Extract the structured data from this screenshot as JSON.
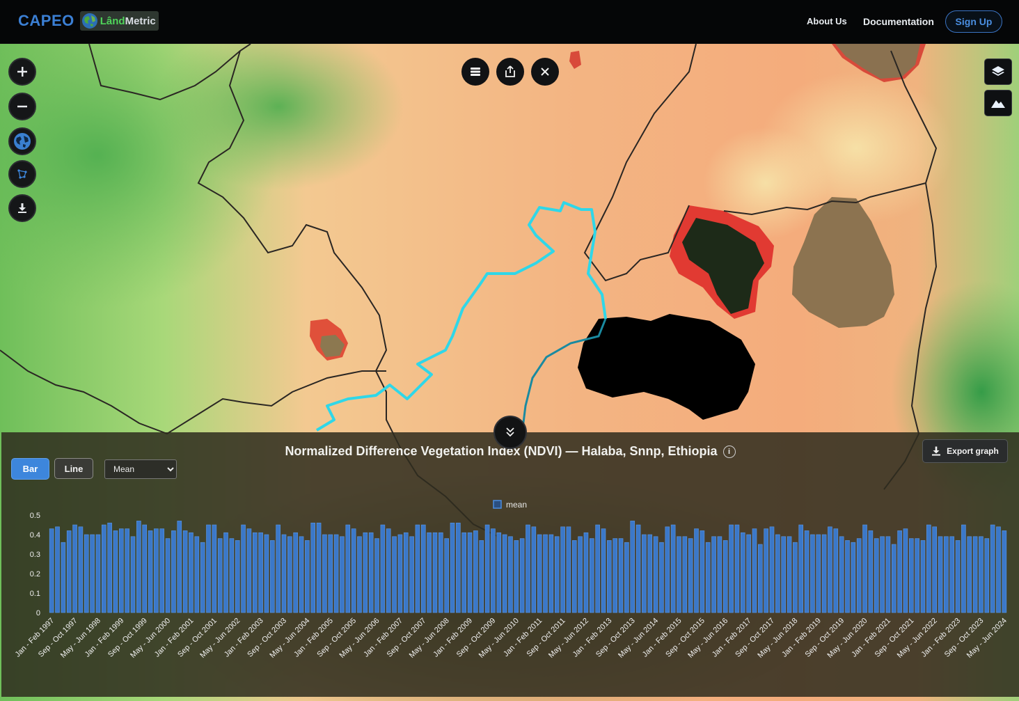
{
  "header": {
    "brand": "CAPEO",
    "logo_land": "Lând",
    "logo_metric": "Metric",
    "nav": [
      "About Us",
      "Documentation"
    ],
    "signup": "Sign Up"
  },
  "map_controls": {
    "left": [
      "plus-icon",
      "minus-icon",
      "globe-icon",
      "draw-polygon-icon",
      "download-icon"
    ],
    "top": [
      "list-icon",
      "share-icon",
      "close-icon"
    ],
    "right": [
      "layers-icon",
      "terrain-icon"
    ]
  },
  "panel": {
    "title": "Normalized Difference Vegetation Index (NDVI) — Halaba, Snnp, Ethiopia",
    "info": "i",
    "export_label": "Export graph",
    "bar_label": "Bar",
    "line_label": "Line",
    "stat_selected": "Mean"
  },
  "colors": {
    "accent": "#3d86dc",
    "bar": "#3b78c9",
    "river": "#2fd7e8"
  },
  "chart_data": {
    "type": "bar",
    "legend": [
      "mean"
    ],
    "ylim": [
      0,
      0.5
    ],
    "yticks": [
      "0",
      "0.1",
      "0.2",
      "0.3",
      "0.4",
      "0.5"
    ],
    "xtick_labels": [
      "Jan - Feb 1997",
      "Sep - Oct 1997",
      "May - Jun 1998",
      "Jan - Feb 1999",
      "Sep - Oct 1999",
      "May - Jun 2000",
      "Jan - Feb 2001",
      "Sep - Oct 2001",
      "May - Jun 2002",
      "Jan - Feb 2003",
      "Sep - Oct 2003",
      "May - Jun 2004",
      "Jan - Feb 2005",
      "Sep - Oct 2005",
      "May - Jun 2006",
      "Jan - Feb 2007",
      "Sep - Oct 2007",
      "May - Jun 2008",
      "Jan - Feb 2009",
      "Sep - Oct 2009",
      "May - Jun 2010",
      "Jan - Feb 2011",
      "Sep - Oct 2011",
      "May - Jun 2012",
      "Jan - Feb 2013",
      "Sep - Oct 2013",
      "May - Jun 2014",
      "Jan - Feb 2015",
      "Sep - Oct 2015",
      "May - Jun 2016",
      "Jan - Feb 2017",
      "Sep - Oct 2017",
      "May - Jun 2018",
      "Jan - Feb 2019",
      "Sep - Oct 2019",
      "May - Jun 2020",
      "Jan - Feb 2021",
      "Sep - Oct 2021",
      "May - Jun 2022",
      "Jan - Feb 2023",
      "Sep - Oct 2023",
      "May - Jun 2024"
    ],
    "series": [
      {
        "name": "mean",
        "values": [
          0.43,
          0.44,
          0.36,
          0.42,
          0.45,
          0.44,
          0.4,
          0.4,
          0.4,
          0.45,
          0.46,
          0.42,
          0.43,
          0.43,
          0.39,
          0.47,
          0.45,
          0.42,
          0.43,
          0.43,
          0.38,
          0.42,
          0.47,
          0.42,
          0.41,
          0.39,
          0.36,
          0.45,
          0.45,
          0.38,
          0.41,
          0.38,
          0.37,
          0.45,
          0.43,
          0.41,
          0.41,
          0.4,
          0.37,
          0.45,
          0.4,
          0.39,
          0.41,
          0.39,
          0.37,
          0.46,
          0.46,
          0.4,
          0.4,
          0.4,
          0.39,
          0.45,
          0.43,
          0.39,
          0.41,
          0.41,
          0.38,
          0.45,
          0.43,
          0.39,
          0.4,
          0.41,
          0.39,
          0.45,
          0.45,
          0.41,
          0.41,
          0.41,
          0.38,
          0.46,
          0.46,
          0.41,
          0.41,
          0.42,
          0.37,
          0.45,
          0.43,
          0.41,
          0.4,
          0.39,
          0.37,
          0.38,
          0.45,
          0.44,
          0.4,
          0.4,
          0.4,
          0.39,
          0.44,
          0.44,
          0.37,
          0.39,
          0.41,
          0.38,
          0.45,
          0.43,
          0.37,
          0.38,
          0.38,
          0.36,
          0.47,
          0.45,
          0.4,
          0.4,
          0.39,
          0.36,
          0.44,
          0.45,
          0.39,
          0.39,
          0.38,
          0.43,
          0.42,
          0.36,
          0.39,
          0.39,
          0.37,
          0.45,
          0.45,
          0.41,
          0.4,
          0.43,
          0.35,
          0.43,
          0.44,
          0.4,
          0.39,
          0.39,
          0.36,
          0.45,
          0.42,
          0.4,
          0.4,
          0.4,
          0.44,
          0.43,
          0.39,
          0.37,
          0.36,
          0.38,
          0.45,
          0.42,
          0.38,
          0.39,
          0.39,
          0.35,
          0.42,
          0.43,
          0.38,
          0.38,
          0.37,
          0.45,
          0.44,
          0.39,
          0.39,
          0.39,
          0.37,
          0.45,
          0.39,
          0.39,
          0.39,
          0.38,
          0.45,
          0.44,
          0.42
        ]
      }
    ]
  }
}
